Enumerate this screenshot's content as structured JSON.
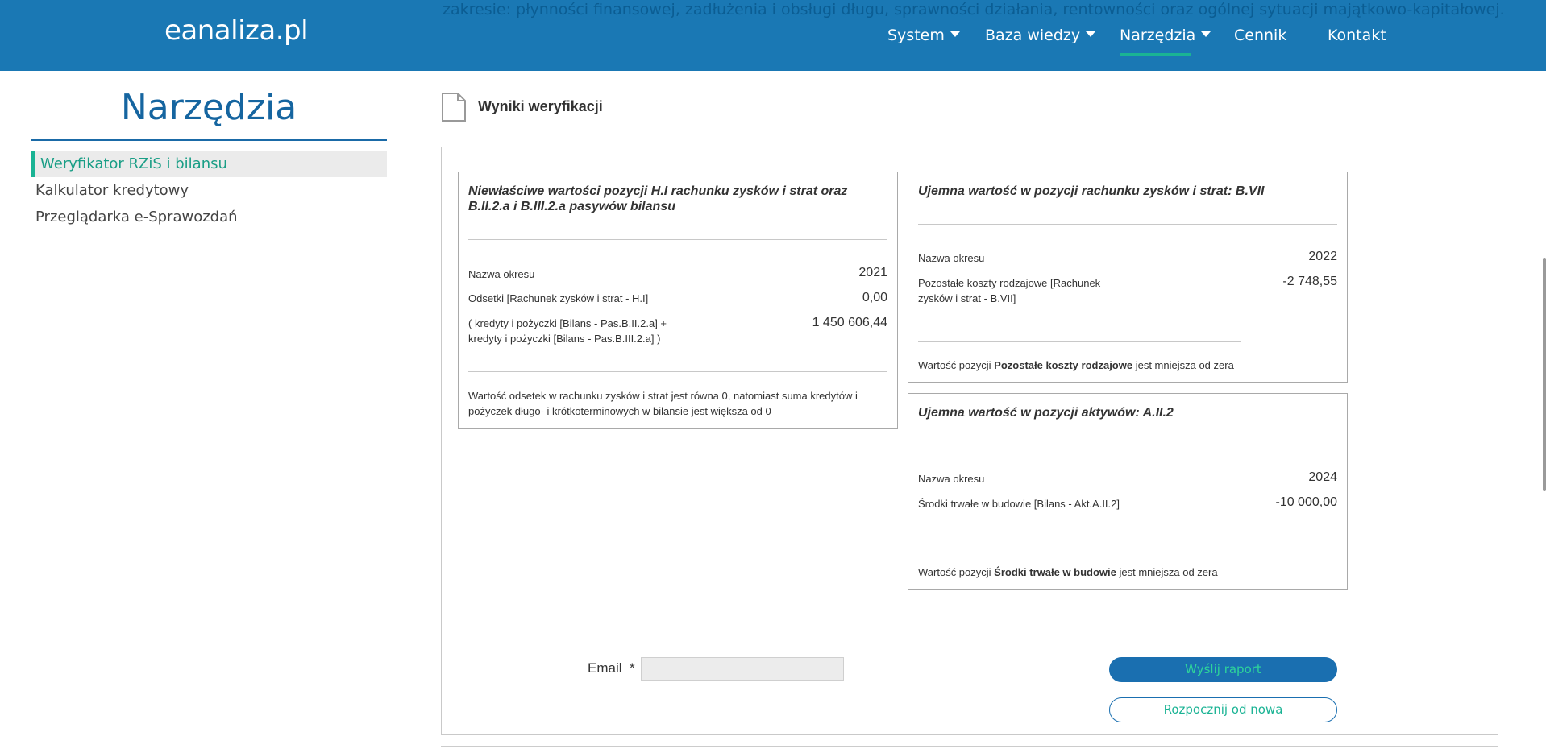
{
  "header": {
    "logo": "eanaliza.pl",
    "background_text": "zakresie: płynności finansowej, zadłużenia i obsługi długu, sprawności działania, rentowności oraz ogólnej sytuacji majątkowo-kapitałowej.",
    "nav": [
      {
        "label": "System",
        "has_dropdown": true
      },
      {
        "label": "Baza wiedzy",
        "has_dropdown": true
      },
      {
        "label": "Narzędzia",
        "has_dropdown": true,
        "active": true
      },
      {
        "label": "Cennik",
        "has_dropdown": false
      },
      {
        "label": "Kontakt",
        "has_dropdown": false
      }
    ]
  },
  "sidebar": {
    "title": "Narzędzia",
    "items": [
      {
        "label": "Weryfikator RZiS i bilansu",
        "active": true
      },
      {
        "label": "Kalkulator kredytowy"
      },
      {
        "label": "Przeglądarka e-Sprawozdań"
      }
    ]
  },
  "results": {
    "title": "Wyniki weryfikacji",
    "cards": [
      {
        "title": "Niewłaściwe wartości pozycji H.I rachunku zysków i strat oraz B.II.2.a i B.III.2.a pasywów bilansu",
        "period_label": "Nazwa okresu",
        "period_value": "2021",
        "rows": [
          {
            "label": "Odsetki [Rachunek zysków i strat - H.I]",
            "value": "0,00"
          },
          {
            "label": "( kredyty i pożyczki [Bilans - Pas.B.II.2.a] + kredyty i pożyczki [Bilans - Pas.B.III.2.a] )",
            "value": "1 450 606,44"
          }
        ],
        "note": "Wartość odsetek w rachunku zysków i strat jest równa 0, natomiast suma kredytów i pożyczek długo- i krótkoterminowych w bilansie jest większa od 0"
      },
      {
        "title": "Ujemna wartość w pozycji rachunku zysków i strat: B.VII",
        "period_label": "Nazwa okresu",
        "period_value": "2022",
        "rows": [
          {
            "label": "Pozostałe koszty rodzajowe [Rachunek zysków i strat - B.VII]",
            "value": "-2 748,55"
          }
        ],
        "note_prefix": "Wartość pozycji ",
        "note_bold": "Pozostałe koszty rodzajowe",
        "note_suffix": " jest mniejsza od zera"
      },
      {
        "title": "Ujemna wartość w pozycji aktywów: A.II.2",
        "period_label": "Nazwa okresu",
        "period_value": "2024",
        "rows": [
          {
            "label": "Środki trwałe w budowie [Bilans - Akt.A.II.2]",
            "value": "-10 000,00"
          }
        ],
        "note_prefix": "Wartość pozycji ",
        "note_bold": "Środki trwałe w budowie",
        "note_suffix": " jest mniejsza od zera"
      }
    ]
  },
  "form": {
    "email_label": "Email",
    "required_marker": "*",
    "email_value": "",
    "send_button": "Wyślij raport",
    "restart_button": "Rozpocznij od nowa"
  },
  "colors": {
    "header_bg": "#1a78b4",
    "accent_green": "#1ab394",
    "title_blue": "#1565a0",
    "primary_button": "#1a6fb0"
  }
}
